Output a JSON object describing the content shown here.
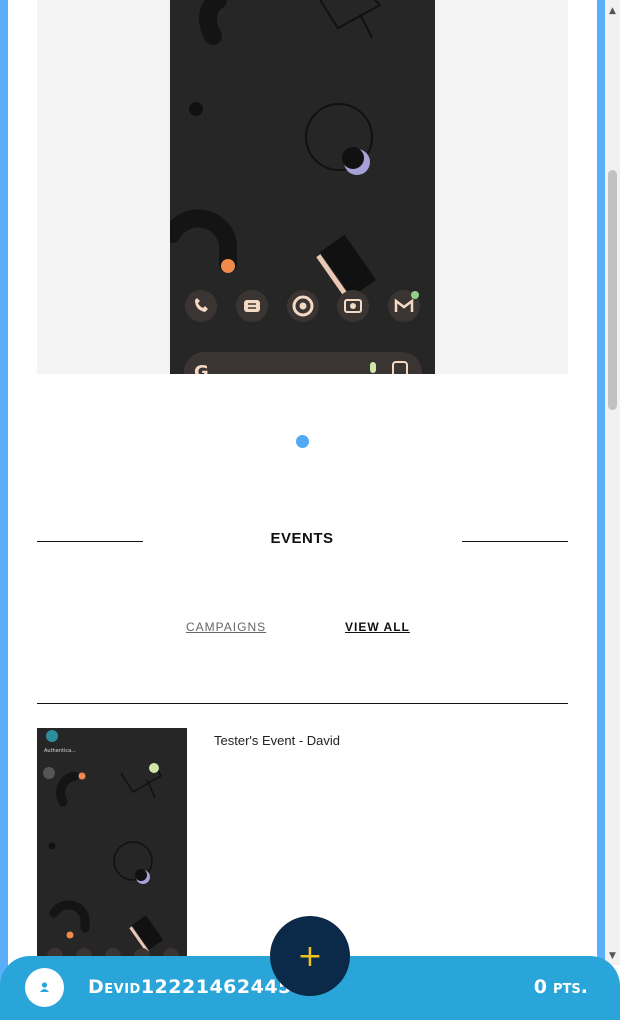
{
  "carousel": {
    "dock_icons": [
      "phone-icon",
      "messages-icon",
      "chrome-icon",
      "camera-icon",
      "gmail-icon"
    ],
    "search_bar_icons": [
      "google-g-icon",
      "mic-icon",
      "lens-icon"
    ],
    "active_slide_indicator_color": "#53a9f4"
  },
  "events": {
    "heading": "EVENTS",
    "tabs": {
      "campaigns": "CAMPAIGNS",
      "view_all": "VIEW ALL"
    },
    "list": [
      {
        "title": "Tester's Event - David",
        "thumb_label": "Authentica..."
      }
    ]
  },
  "bottom_bar": {
    "username": "Devid12221462445",
    "points_value": "0",
    "points_unit": "pts.",
    "fab_icon": "plus-icon",
    "bar_color": "#2aa5d9",
    "fab_color": "#0b2a4a"
  }
}
